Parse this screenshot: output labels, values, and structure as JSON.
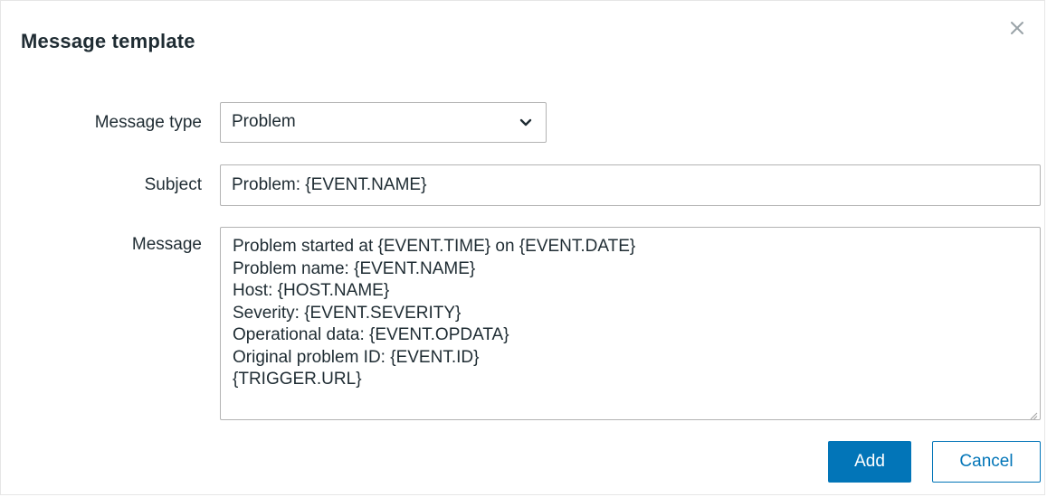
{
  "dialog": {
    "title": "Message template",
    "close_icon": "close-icon"
  },
  "form": {
    "message_type": {
      "label": "Message type",
      "value": "Problem",
      "icon": "chevron-down-icon"
    },
    "subject": {
      "label": "Subject",
      "value": "Problem: {EVENT.NAME}"
    },
    "message": {
      "label": "Message",
      "lines": [
        "Problem started at {EVENT.TIME} on {EVENT.DATE}",
        "Problem name: {EVENT.NAME}",
        "Host: {HOST.NAME}",
        "Severity: {EVENT.SEVERITY}",
        "Operational data: {EVENT.OPDATA}",
        "Original problem ID: {EVENT.ID}",
        "{TRIGGER.URL}"
      ]
    }
  },
  "buttons": {
    "add_label": "Add",
    "cancel_label": "Cancel"
  },
  "colors": {
    "primary": "#0275b8",
    "text": "#1f2c33",
    "border": "#b3b3b3"
  }
}
